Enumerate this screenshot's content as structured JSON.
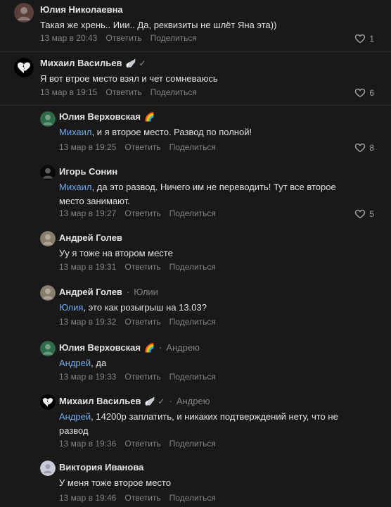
{
  "actions": {
    "reply": "Ответить",
    "share": "Поделиться"
  },
  "comments": [
    {
      "author": "Юлия Николаевна",
      "badge": "",
      "verified": false,
      "reply_to": "",
      "mention": "",
      "text": "Такая же хрень.. Иии.. Да, реквизиты не шлёт Яна эта))",
      "text2": "",
      "date": "13 мар в 20:43",
      "likes": "1",
      "avatar_color": "#5a3f3a"
    },
    {
      "author": "Михаил Васильев",
      "badge": "🪽",
      "verified": true,
      "reply_to": "",
      "mention": "",
      "text": "Я вот втрое место взял и чет сомневаюсь",
      "text2": "",
      "date": "13 мар в 19:15",
      "likes": "6",
      "avatar_color": "#000000"
    },
    {
      "author": "Юлия Верховская",
      "badge": "🌈",
      "verified": false,
      "reply_to": "",
      "mention": "Михаил",
      "text": ", и я второе место. Развод по полной!",
      "text2": "",
      "date": "13 мар в 19:25",
      "likes": "8",
      "avatar_color": "#2d6b4a"
    },
    {
      "author": "Игорь Сонин",
      "badge": "",
      "verified": false,
      "reply_to": "",
      "mention": "Михаил",
      "text": ", да это развод. Ничего им не переводить! Тут все второе",
      "text2": "место занимают.",
      "date": "13 мар в 19:27",
      "likes": "5",
      "avatar_color": "#0a0a0a"
    },
    {
      "author": "Андрей Голев",
      "badge": "",
      "verified": false,
      "reply_to": "",
      "mention": "",
      "text": "Уу я тоже на втором месте",
      "text2": "",
      "date": "13 мар в 19:31",
      "likes": "",
      "avatar_color": "#8a7f6c"
    },
    {
      "author": "Андрей Голев",
      "badge": "",
      "verified": false,
      "reply_to": "Юлии",
      "mention": "Юлия",
      "text": ", это как розыгрыш на 13.03?",
      "text2": "",
      "date": "13 мар в 19:32",
      "likes": "",
      "avatar_color": "#8a7f6c"
    },
    {
      "author": "Юлия Верховская",
      "badge": "🌈",
      "verified": false,
      "reply_to": "Андрею",
      "mention": "Андрей",
      "text": ", да",
      "text2": "",
      "date": "13 мар в 19:33",
      "likes": "",
      "avatar_color": "#2d6b4a"
    },
    {
      "author": "Михаил Васильев",
      "badge": "🪽",
      "verified": true,
      "reply_to": "Андрею",
      "mention": "Андрей",
      "text": ", 14200р заплатить, и никаких подтверждений нету, что не",
      "text2": "развод",
      "date": "13 мар в 19:36",
      "likes": "",
      "avatar_color": "#000000"
    },
    {
      "author": "Виктория Иванова",
      "badge": "",
      "verified": false,
      "reply_to": "",
      "mention": "",
      "text": "У меня тоже второе место",
      "text2": "",
      "date": "13 мар в 19:46",
      "likes": "",
      "avatar_color": "#c9ccd6"
    }
  ]
}
